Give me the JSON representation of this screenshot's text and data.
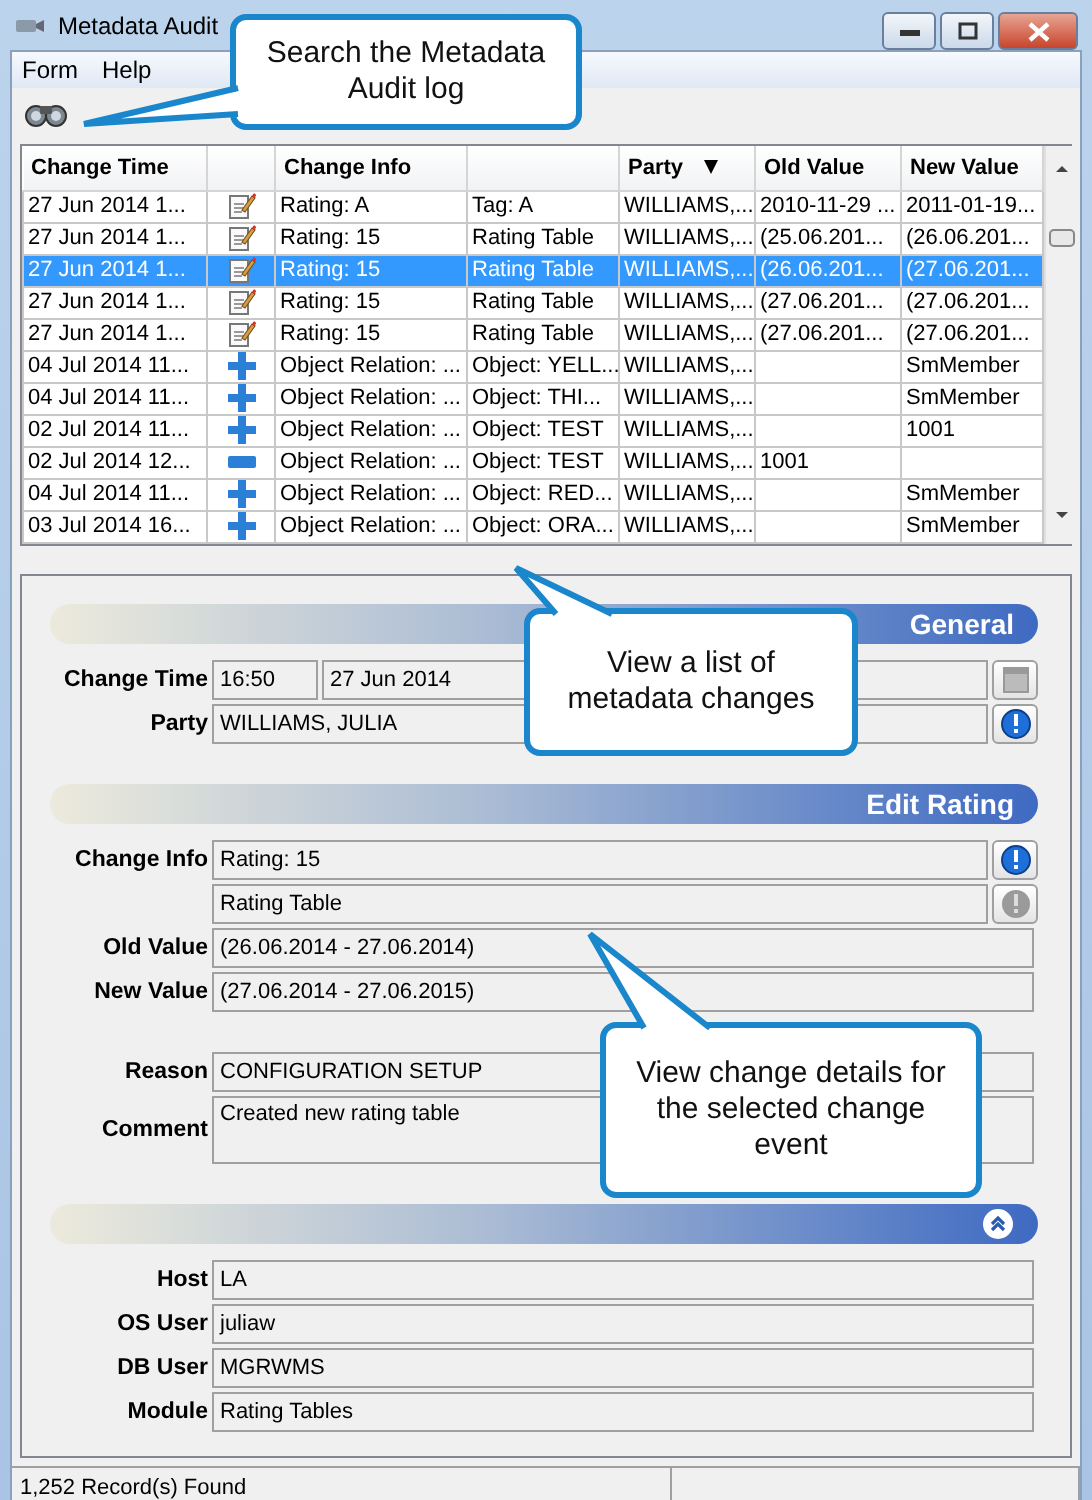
{
  "window": {
    "title": "Metadata Audit"
  },
  "menu": [
    {
      "label": "Form"
    },
    {
      "label": "Help"
    }
  ],
  "table": {
    "columns": [
      {
        "kind": "text",
        "label": "Change Time"
      },
      {
        "kind": "blank"
      },
      {
        "kind": "text",
        "label": "Change Info"
      },
      {
        "kind": "blank"
      },
      {
        "kind": "text",
        "label": "Party",
        "sorted": true
      },
      {
        "kind": "text",
        "label": "Old Value"
      },
      {
        "kind": "text",
        "label": "New Value"
      }
    ],
    "rows": [
      {
        "change_time": "27 Jun 2014 1...",
        "kind": "edit",
        "change_info": "Rating: A",
        "column_4": "Tag: A",
        "party": "WILLIAMS,...",
        "old_value": "2010-11-29 ...",
        "new_value": "2011-01-19...",
        "selected": false
      },
      {
        "change_time": "27 Jun 2014 1...",
        "kind": "edit",
        "change_info": "Rating: 15",
        "column_4": "Rating Table",
        "party": "WILLIAMS,...",
        "old_value": "(25.06.201...",
        "new_value": "(26.06.201...",
        "selected": false
      },
      {
        "change_time": "27 Jun 2014 1...",
        "kind": "edit",
        "change_info": "Rating: 15",
        "column_4": "Rating Table",
        "party": "WILLIAMS,...",
        "old_value": "(26.06.201...",
        "new_value": "(27.06.201...",
        "selected": true
      },
      {
        "change_time": "27 Jun 2014 1...",
        "kind": "edit",
        "change_info": "Rating: 15",
        "column_4": "Rating Table",
        "party": "WILLIAMS,...",
        "old_value": "(27.06.201...",
        "new_value": "(27.06.201...",
        "selected": false
      },
      {
        "change_time": "27 Jun 2014 1...",
        "kind": "edit",
        "change_info": "Rating: 15",
        "column_4": "Rating Table",
        "party": "WILLIAMS,...",
        "old_value": "(27.06.201...",
        "new_value": "(27.06.201...",
        "selected": false
      },
      {
        "change_time": "04 Jul 2014 11...",
        "kind": "add",
        "change_info": "Object Relation: ...",
        "column_4": "Object: YELL...",
        "party": "WILLIAMS,...",
        "new_value": "SmMember",
        "selected": false
      },
      {
        "change_time": "04 Jul 2014 11...",
        "kind": "add",
        "change_info": "Object Relation: ...",
        "column_4": "Object: THI...",
        "party": "WILLIAMS,...",
        "new_value": "SmMember",
        "selected": false
      },
      {
        "change_time": "02 Jul 2014 11...",
        "kind": "add",
        "change_info": "Object Relation: ...",
        "column_4": "Object: TEST",
        "party": "WILLIAMS,...",
        "new_value": "1001",
        "selected": false
      },
      {
        "change_time": "02 Jul 2014 12...",
        "kind": "remove",
        "change_info": "Object Relation: ...",
        "column_4": "Object: TEST",
        "party": "WILLIAMS,...",
        "old_value": "1001",
        "selected": false
      },
      {
        "change_time": "04 Jul 2014 11...",
        "kind": "add",
        "change_info": "Object Relation: ...",
        "column_4": "Object: RED...",
        "party": "WILLIAMS,...",
        "new_value": "SmMember",
        "selected": false
      },
      {
        "change_time": "03 Jul 2014 16...",
        "kind": "add",
        "change_info": "Object Relation: ...",
        "column_4": "Object: ORA...",
        "party": "WILLIAMS,...",
        "new_value": "SmMember",
        "selected": false
      }
    ]
  },
  "sections": [
    {
      "title": "General",
      "groups": [
        [
          {
            "label": "Change Time",
            "values": [
              "16:50",
              "27 Jun 2014"
            ],
            "button": {
              "kind": "calendar"
            }
          },
          {
            "label": "Party",
            "values": [
              "WILLIAMS, JULIA"
            ],
            "button": {
              "kind": "info"
            }
          }
        ]
      ]
    },
    {
      "title": "Edit Rating",
      "groups": [
        [
          {
            "label": "Change Info",
            "values": [
              "Rating: 15"
            ],
            "button": {
              "kind": "info"
            }
          },
          {
            "values": [
              "Rating Table"
            ],
            "button": {
              "kind": "info_disabled"
            }
          },
          {
            "label": "Old Value",
            "values": [
              "(26.06.2014 - 27.06.2014)"
            ]
          },
          {
            "label": "New Value",
            "values": [
              "(27.06.2014 - 27.06.2015)"
            ]
          }
        ],
        [
          {
            "label": "Reason",
            "values": [
              "CONFIGURATION SETUP"
            ]
          },
          {
            "label": "Comment",
            "values": [
              "Created new rating table"
            ],
            "kind": "multiline"
          }
        ]
      ]
    },
    {
      "collapsible": true,
      "groups": [
        [
          {
            "label": "Host",
            "values": [
              "LA"
            ]
          },
          {
            "label": "OS User",
            "values": [
              "juliaw"
            ]
          },
          {
            "label": "DB User",
            "values": [
              "MGRWMS"
            ]
          },
          {
            "label": "Module",
            "values": [
              "Rating Tables"
            ]
          }
        ]
      ]
    }
  ],
  "status_bar": {
    "panes": [
      "1,252 Record(s) Found"
    ]
  },
  "callouts": [
    {
      "text": "Search the Metadata Audit log"
    },
    {
      "text": "View a list of metadata changes"
    },
    {
      "text": "View change details for the selected change event"
    }
  ]
}
